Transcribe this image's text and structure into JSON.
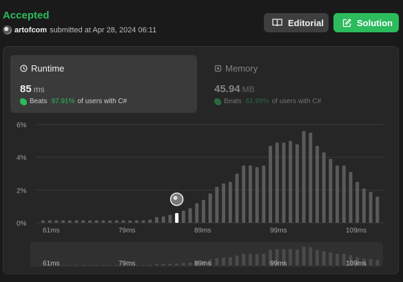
{
  "header": {
    "status": "Accepted",
    "username": "artofcom",
    "submitted_text": "submitted at Apr 28, 2024 06:11"
  },
  "buttons": {
    "editorial": "Editorial",
    "solution": "Solution"
  },
  "runtime": {
    "title": "Runtime",
    "value": "85",
    "unit": "ms",
    "beats_label": "Beats",
    "beats_pct": "97.91%",
    "beats_suffix": "of users with C#"
  },
  "memory": {
    "title": "Memory",
    "value": "45.94",
    "unit": "MB",
    "beats_label": "Beats",
    "beats_pct": "61.99%",
    "beats_suffix": "of users with C#"
  },
  "colors": {
    "accent": "#2cbb5d",
    "bar": "#5a5a5a",
    "bar_selected": "#ffffff"
  },
  "chart_data": {
    "type": "bar",
    "y_ticks": [
      "6%",
      "4%",
      "2%",
      "0%"
    ],
    "x_ticks": [
      "61ms",
      "79ms",
      "89ms",
      "99ms",
      "109ms"
    ],
    "ylim": [
      0,
      6
    ],
    "selected_index": 20,
    "values": [
      0.15,
      0.15,
      0.15,
      0.15,
      0.15,
      0.15,
      0.15,
      0.15,
      0.15,
      0.15,
      0.15,
      0.15,
      0.15,
      0.15,
      0.15,
      0.15,
      0.2,
      0.35,
      0.4,
      0.5,
      0.6,
      0.75,
      0.9,
      1.2,
      1.4,
      1.8,
      2.2,
      2.4,
      2.5,
      3.0,
      3.5,
      3.5,
      3.4,
      3.5,
      4.7,
      4.9,
      4.9,
      5.0,
      4.8,
      5.6,
      5.5,
      4.7,
      4.3,
      3.9,
      3.5,
      3.5,
      3.1,
      2.5,
      2.1,
      1.9,
      1.6
    ]
  }
}
